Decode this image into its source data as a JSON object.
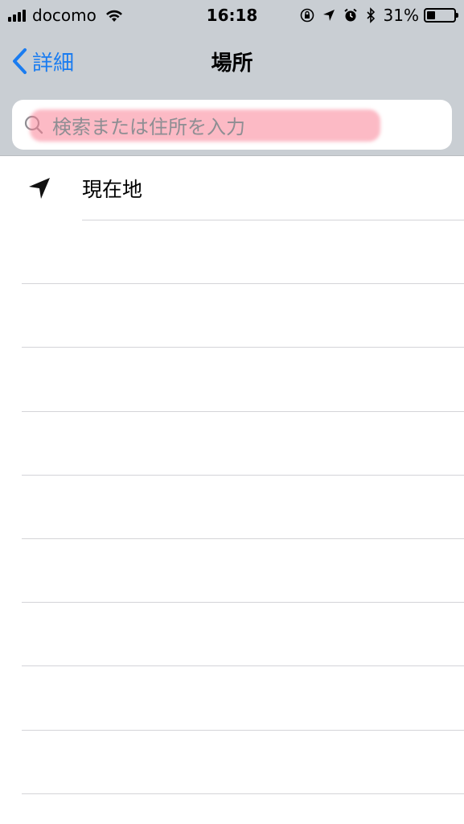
{
  "status_bar": {
    "carrier": "docomo",
    "time": "16:18",
    "battery_percent": "31%",
    "battery_level": 0.31,
    "icons": [
      "signal-bars-icon",
      "wifi-icon",
      "rotation-lock-icon",
      "location-arrow-icon",
      "alarm-icon",
      "bluetooth-icon",
      "battery-icon"
    ]
  },
  "nav": {
    "back_label": "詳細",
    "title": "場所"
  },
  "search": {
    "placeholder": "検索または住所を入力"
  },
  "list": {
    "items": [
      {
        "label": "現在地",
        "icon": "location-arrow-icon"
      }
    ],
    "empty_rows": 9
  },
  "colors": {
    "accent": "#1a7cf0",
    "bar_background": "#c9ced3",
    "highlight": "#fa8296"
  }
}
